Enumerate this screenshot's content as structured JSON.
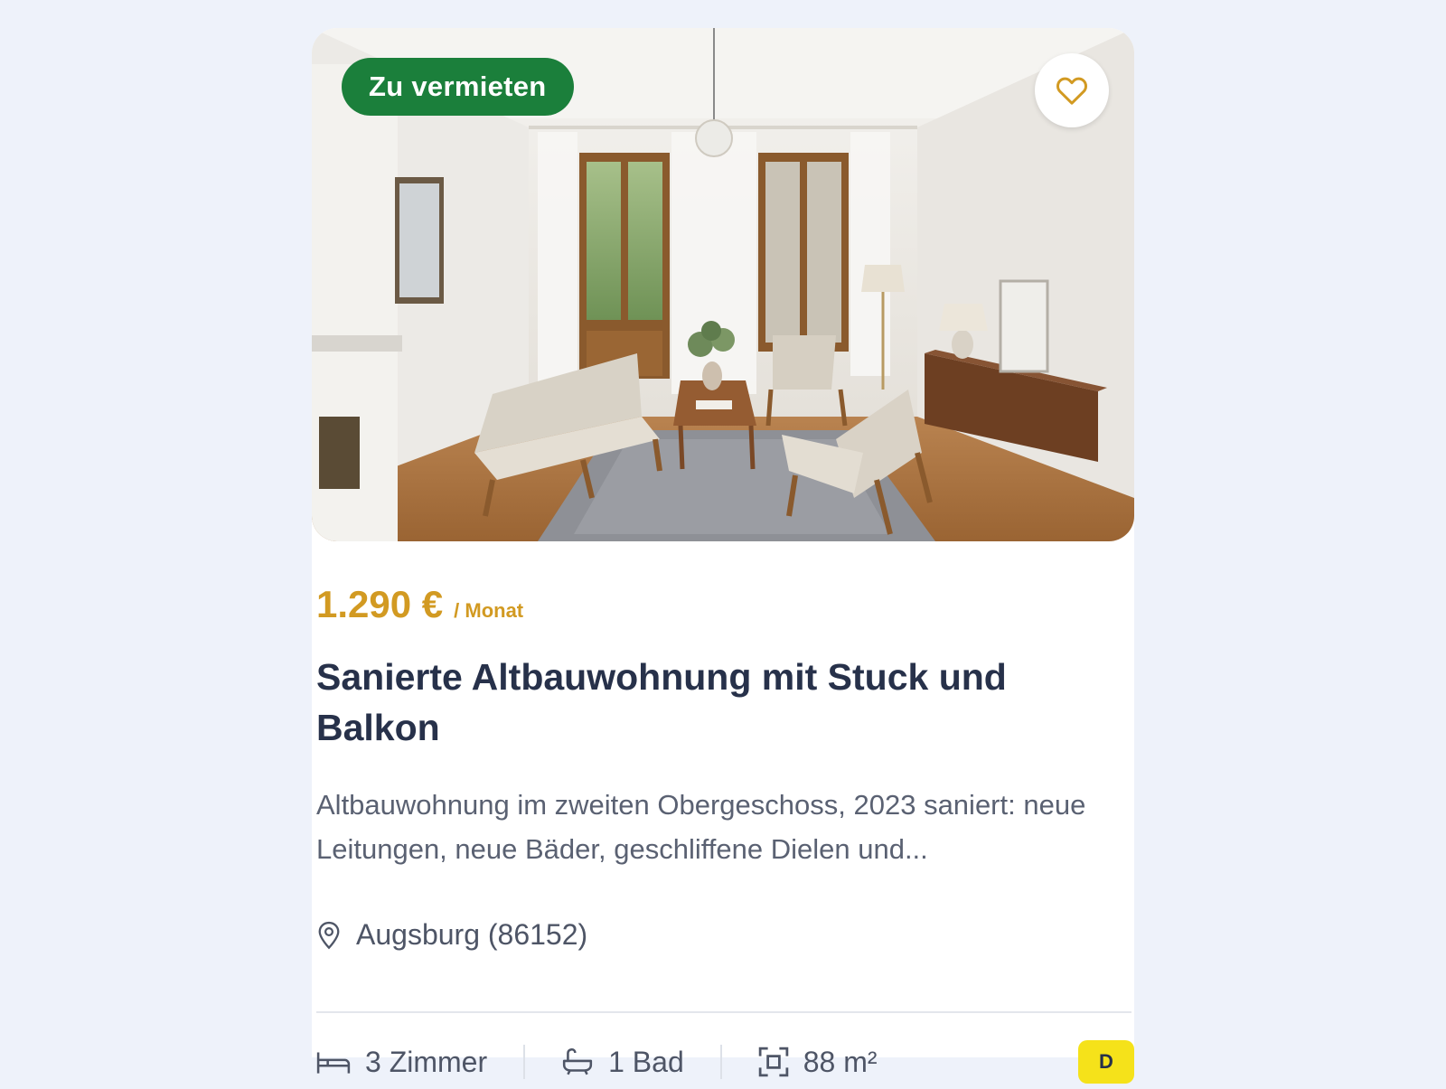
{
  "listing": {
    "badge": "Zu vermieten",
    "price": "1.290 €",
    "price_period": "/ Monat",
    "title": "Sanierte Altbauwohnung mit Stuck und Balkon",
    "description": "Altbauwohnung im zweiten Obergeschoss, 2023 saniert: neue Leitungen, neue Bäder, geschliffene Dielen und...",
    "location": "Augsburg (86152)",
    "rooms": "3 Zimmer",
    "baths": "1 Bad",
    "area": "88 m²",
    "energy_class": "D"
  },
  "icons": {
    "favorite": "heart-icon",
    "location": "map-pin-icon",
    "rooms": "bed-icon",
    "baths": "bathtub-icon",
    "area": "area-frame-icon"
  },
  "colors": {
    "background": "#eef2fa",
    "badge": "#1b7f3b",
    "price": "#d29a22",
    "title": "#27314a",
    "energy": "#f5e21a"
  }
}
